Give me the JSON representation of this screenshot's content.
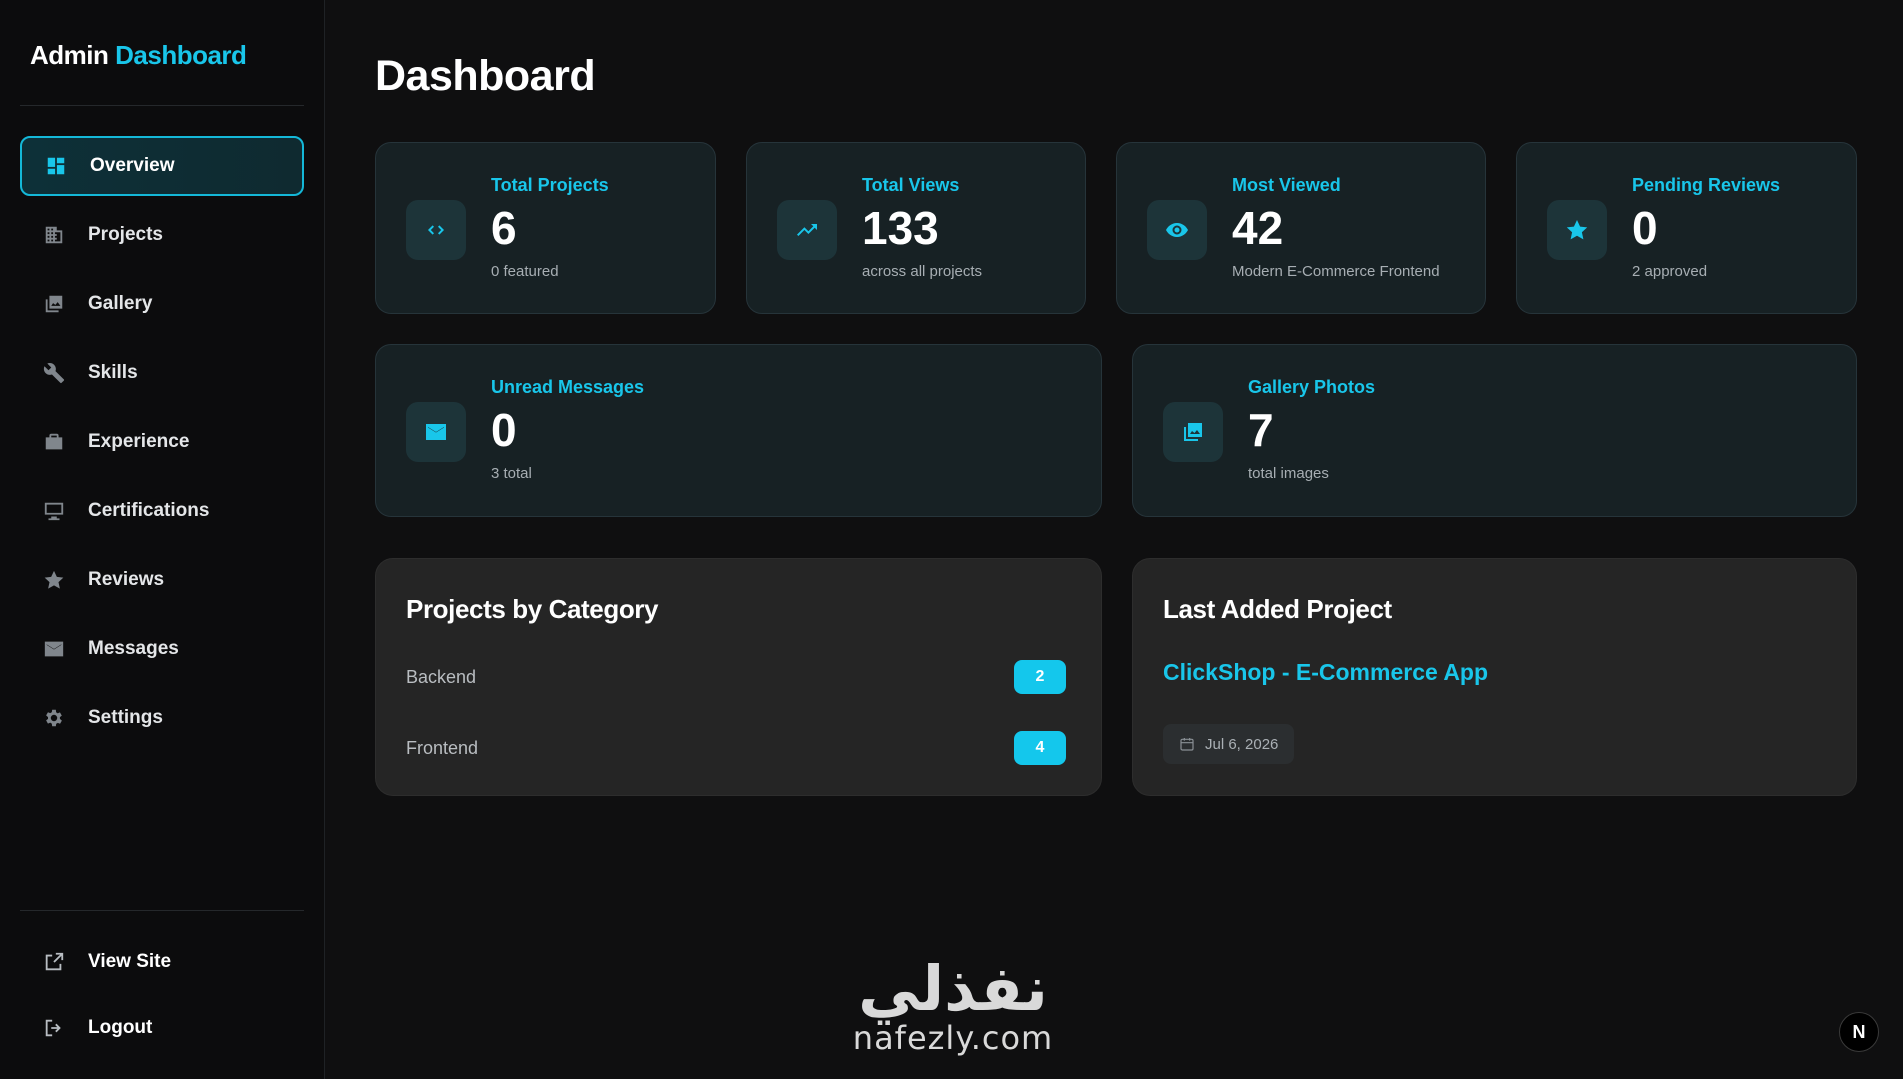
{
  "brand": {
    "part1": "Admin",
    "part2": "Dashboard"
  },
  "sidebar": {
    "items": [
      {
        "label": "Overview",
        "icon": "grid-icon",
        "active": true
      },
      {
        "label": "Projects",
        "icon": "building-icon"
      },
      {
        "label": "Gallery",
        "icon": "photos-icon"
      },
      {
        "label": "Skills",
        "icon": "wrench-icon"
      },
      {
        "label": "Experience",
        "icon": "briefcase-icon"
      },
      {
        "label": "Certifications",
        "icon": "monitor-icon"
      },
      {
        "label": "Reviews",
        "icon": "star-icon"
      },
      {
        "label": "Messages",
        "icon": "mail-icon"
      },
      {
        "label": "Settings",
        "icon": "gear-icon"
      }
    ],
    "footer": [
      {
        "label": "View Site",
        "icon": "external-link-icon"
      },
      {
        "label": "Logout",
        "icon": "logout-icon"
      }
    ]
  },
  "page": {
    "title": "Dashboard"
  },
  "stats": {
    "total_projects": {
      "label": "Total Projects",
      "value": "6",
      "sub": "0 featured",
      "icon": "code-icon"
    },
    "total_views": {
      "label": "Total Views",
      "value": "133",
      "sub": "across all projects",
      "icon": "trending-up-icon"
    },
    "most_viewed": {
      "label": "Most Viewed",
      "value": "42",
      "sub": "Modern E-Commerce Frontend",
      "icon": "eye-icon"
    },
    "pending_reviews": {
      "label": "Pending Reviews",
      "value": "0",
      "sub": "2 approved",
      "icon": "star-icon"
    },
    "unread_messages": {
      "label": "Unread Messages",
      "value": "0",
      "sub": "3 total",
      "icon": "mail-icon"
    },
    "gallery_photos": {
      "label": "Gallery Photos",
      "value": "7",
      "sub": "total images",
      "icon": "photos-icon"
    }
  },
  "categories": {
    "title": "Projects by Category",
    "items": [
      {
        "name": "Backend",
        "count": "2"
      },
      {
        "name": "Frontend",
        "count": "4"
      }
    ]
  },
  "last_project": {
    "title": "Last Added Project",
    "name": "ClickShop - E-Commerce App",
    "date": "Jul 6, 2026"
  },
  "watermark": {
    "arabic": "نفذلي",
    "latin": "nafezly.com"
  },
  "corner_badge": "N",
  "colors": {
    "accent": "#19c6ea",
    "background": "#0f0f10",
    "card": "#172124",
    "panel": "#252525"
  }
}
